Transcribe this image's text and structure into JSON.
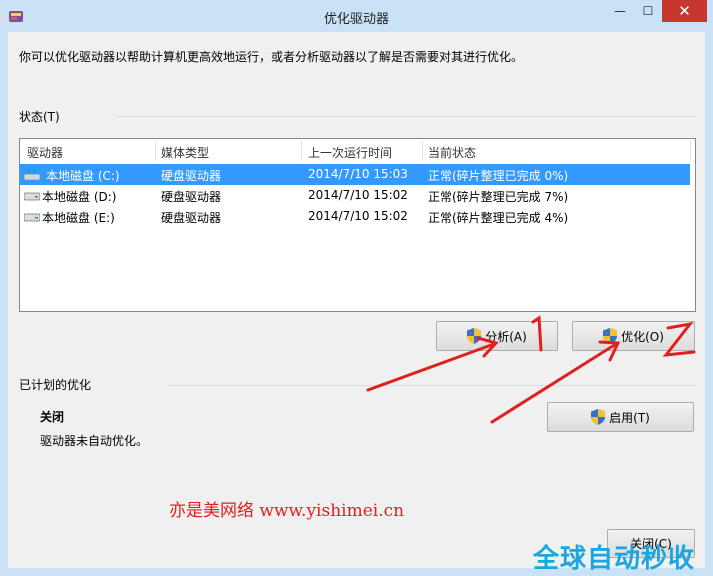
{
  "window": {
    "title": "优化驱动器",
    "close_glyph": "✕",
    "max_glyph": "☐",
    "min_glyph": "—"
  },
  "intro": "你可以优化驱动器以帮助计算机更高效地运行，或者分析驱动器以了解是否需要对其进行优化。",
  "status_section": {
    "label": "状态(T)",
    "columns": [
      "驱动器",
      "媒体类型",
      "上一次运行时间",
      "当前状态"
    ],
    "rows": [
      {
        "drive": "本地磁盘 (C:)",
        "media": "硬盘驱动器",
        "last_run": "2014/7/10 15:03",
        "status": "正常(碎片整理已完成 0%)",
        "selected": true,
        "icon": "windows-drive-icon"
      },
      {
        "drive": "本地磁盘 (D:)",
        "media": "硬盘驱动器",
        "last_run": "2014/7/10 15:02",
        "status": "正常(碎片整理已完成 7%)",
        "selected": false,
        "icon": "hard-drive-icon"
      },
      {
        "drive": "本地磁盘 (E:)",
        "media": "硬盘驱动器",
        "last_run": "2014/7/10 15:02",
        "status": "正常(碎片整理已完成 4%)",
        "selected": false,
        "icon": "hard-drive-icon"
      }
    ],
    "analyze_button": "分析(A)",
    "optimize_button": "优化(O)"
  },
  "schedule_section": {
    "label": "已计划的优化",
    "state": "关闭",
    "description": "驱动器未自动优化。",
    "enable_button": "启用(T)"
  },
  "close_button": "关闭(C)",
  "annotations": {
    "watermark_text": "亦是美网络 www.yishimei.cn",
    "corner_watermark": "全球自动秒收"
  },
  "colors": {
    "selection": "#3399ff",
    "annotation": "#e0201e",
    "close_button": "#c7372f"
  }
}
